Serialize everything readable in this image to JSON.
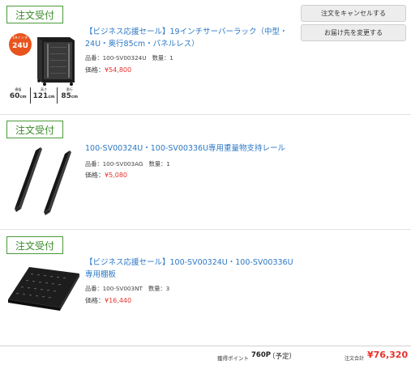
{
  "actions": {
    "cancel_label": "注文をキャンセルする",
    "change_address_label": "お届け先を変更する"
  },
  "items": [
    {
      "status": "注文受付",
      "title": "【ビジネス応援セール】19インチサーバーラック（中型・24U・奥行85cm・パネルレス）",
      "part_label": "品番：100-SV00324U",
      "qty_label": "数量：1",
      "price_label": "価格：",
      "price": "¥54,800",
      "image": {
        "badge_top": "19インチ",
        "badge_main": "24U",
        "dims": [
          {
            "label": "横幅",
            "value": "60",
            "unit": "cm"
          },
          {
            "label": "高さ",
            "value": "121",
            "unit": "cm"
          },
          {
            "label": "奥行",
            "value": "85",
            "unit": "cm"
          }
        ]
      }
    },
    {
      "status": "注文受付",
      "title": "100-SV00324U・100-SV00336U専用重量物支持レール",
      "part_label": "品番：100-SV003AG",
      "qty_label": "数量：1",
      "price_label": "価格：",
      "price": "¥5,080"
    },
    {
      "status": "注文受付",
      "title": "【ビジネス応援セール】100-SV00324U・100-SV00336U専用棚板",
      "part_label": "品番：100-SV003NT",
      "qty_label": "数量：3",
      "price_label": "価格：",
      "price": "¥16,440"
    }
  ],
  "summary": {
    "points_label": "獲得ポイント",
    "points_value": "760P",
    "points_note": "（予定）",
    "total_label": "注文合計",
    "total_value": "¥76,320"
  },
  "colors": {
    "status_green": "#3a8a2a",
    "link_blue": "#2b78c6",
    "price_red": "#e5322d"
  }
}
